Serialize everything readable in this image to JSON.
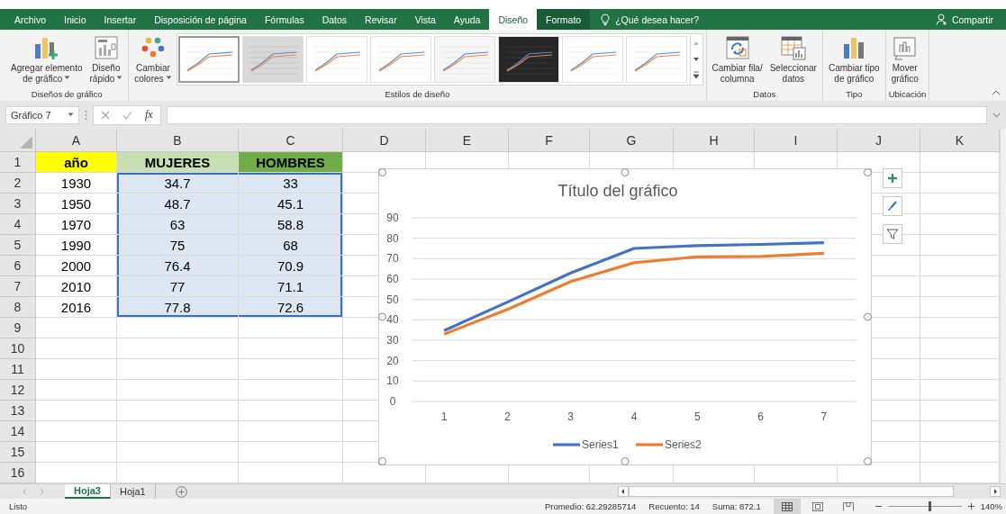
{
  "ribbon_tabs": [
    {
      "label": "Archivo",
      "selected": false,
      "contextual": false
    },
    {
      "label": "Inicio",
      "selected": false,
      "contextual": false
    },
    {
      "label": "Insertar",
      "selected": false,
      "contextual": false
    },
    {
      "label": "Disposición de página",
      "selected": false,
      "contextual": false
    },
    {
      "label": "Fórmulas",
      "selected": false,
      "contextual": false
    },
    {
      "label": "Datos",
      "selected": false,
      "contextual": false
    },
    {
      "label": "Revisar",
      "selected": false,
      "contextual": false
    },
    {
      "label": "Vista",
      "selected": false,
      "contextual": false
    },
    {
      "label": "Ayuda",
      "selected": false,
      "contextual": false
    },
    {
      "label": "Diseño",
      "selected": true,
      "contextual": true
    },
    {
      "label": "Formato",
      "selected": false,
      "contextual": true
    }
  ],
  "tell_me": {
    "placeholder": "¿Qué desea hacer?"
  },
  "share": "Compartir",
  "ribbon": {
    "groups": [
      {
        "label": "Diseños de gráfico",
        "items": [
          {
            "kind": "button",
            "lines": [
              "Agregar elemento",
              "de gráfico"
            ],
            "dropdown": true
          },
          {
            "kind": "button",
            "lines": [
              "Diseño",
              "rápido"
            ],
            "dropdown": true
          }
        ]
      },
      {
        "label": "Estilos de diseño",
        "items": [
          {
            "kind": "button",
            "lines": [
              "Cambiar",
              "colores"
            ],
            "dropdown": true
          },
          {
            "kind": "gallery",
            "styles": [
              {
                "kind": "plain",
                "selected": true
              },
              {
                "kind": "shaded",
                "selected": false
              },
              {
                "kind": "plain",
                "selected": false
              },
              {
                "kind": "plain",
                "selected": false
              },
              {
                "kind": "hatched",
                "selected": false
              },
              {
                "kind": "dark",
                "selected": false
              },
              {
                "kind": "plain",
                "selected": false
              },
              {
                "kind": "plain",
                "selected": false
              }
            ]
          }
        ]
      },
      {
        "label": "Datos",
        "items": [
          {
            "kind": "button",
            "lines": [
              "Cambiar fila/",
              "columna"
            ],
            "dropdown": false
          },
          {
            "kind": "button",
            "lines": [
              "Seleccionar",
              "datos"
            ],
            "dropdown": false
          }
        ]
      },
      {
        "label": "Tipo",
        "items": [
          {
            "kind": "button",
            "lines": [
              "Cambiar tipo",
              "de gráfico"
            ],
            "dropdown": false
          }
        ]
      },
      {
        "label": "Ubicación",
        "items": [
          {
            "kind": "button",
            "lines": [
              "Mover",
              "gráfico"
            ],
            "dropdown": false
          }
        ]
      }
    ]
  },
  "formula_bar": {
    "name_box": "Gráfico 7",
    "function_label": "fx"
  },
  "sheet": {
    "columns": [
      "A",
      "B",
      "C",
      "D",
      "E",
      "F",
      "G",
      "H",
      "I",
      "J",
      "K"
    ],
    "row_numbers": [
      "1",
      "2",
      "3",
      "4",
      "5",
      "6",
      "7",
      "8",
      "9",
      "10",
      "11",
      "12",
      "13",
      "14",
      "15",
      "16"
    ],
    "rows": [
      {
        "cells": [
          {
            "text": "año",
            "color": "#ffff00",
            "selected": false
          },
          {
            "text": "MUJERES",
            "color": "#c6e0b4",
            "selected": false
          },
          {
            "text": "HOMBRES",
            "color": "#70ad47",
            "selected": false
          }
        ]
      },
      {
        "cells": [
          {
            "text": "1930",
            "selected": false
          },
          {
            "text": "34.7",
            "selected": true
          },
          {
            "text": "33",
            "selected": true
          }
        ]
      },
      {
        "cells": [
          {
            "text": "1950",
            "selected": false
          },
          {
            "text": "48.7",
            "selected": true
          },
          {
            "text": "45.1",
            "selected": true
          }
        ]
      },
      {
        "cells": [
          {
            "text": "1970",
            "selected": false
          },
          {
            "text": "63",
            "selected": true
          },
          {
            "text": "58.8",
            "selected": true
          }
        ]
      },
      {
        "cells": [
          {
            "text": "1990",
            "selected": false
          },
          {
            "text": "75",
            "selected": true
          },
          {
            "text": "68",
            "selected": true
          }
        ]
      },
      {
        "cells": [
          {
            "text": "2000",
            "selected": false
          },
          {
            "text": "76.4",
            "selected": true
          },
          {
            "text": "70.9",
            "selected": true
          }
        ]
      },
      {
        "cells": [
          {
            "text": "2010",
            "selected": false
          },
          {
            "text": "77",
            "selected": true
          },
          {
            "text": "71.1",
            "selected": true
          }
        ]
      },
      {
        "cells": [
          {
            "text": "2016",
            "selected": false
          },
          {
            "text": "77.8",
            "selected": true
          },
          {
            "text": "72.6",
            "selected": true
          }
        ]
      }
    ],
    "chart_data": {
      "type": "line",
      "title": "Título del gráfico",
      "categories": [
        "1",
        "2",
        "3",
        "4",
        "5",
        "6",
        "7"
      ],
      "series": [
        {
          "name": "Series1",
          "color": "#4472c4",
          "values": [
            34.7,
            48.7,
            63,
            75,
            76.4,
            77,
            77.8
          ]
        },
        {
          "name": "Series2",
          "color": "#ed7d31",
          "values": [
            33,
            45.1,
            58.8,
            68,
            70.9,
            71.1,
            72.6
          ]
        }
      ],
      "ylim": [
        0,
        90
      ],
      "yticks": [
        0,
        10,
        20,
        30,
        40,
        50,
        60,
        70,
        80,
        90
      ],
      "grid": true,
      "legend": "bottom"
    }
  },
  "sheet_tabs": [
    {
      "label": "Hoja3",
      "selected": true
    },
    {
      "label": "Hoja1",
      "selected": false
    }
  ],
  "status_bar": {
    "status": "Listo",
    "average": "Promedio: 62.29285714",
    "count": "Recuento: 14",
    "sum": "Suma: 872.1",
    "views": [
      {
        "kind": "normal",
        "selected": true
      },
      {
        "kind": "page-layout",
        "selected": false
      },
      {
        "kind": "page-break",
        "selected": false
      }
    ],
    "zoom": {
      "level": 0.57,
      "reading": "140%"
    }
  }
}
